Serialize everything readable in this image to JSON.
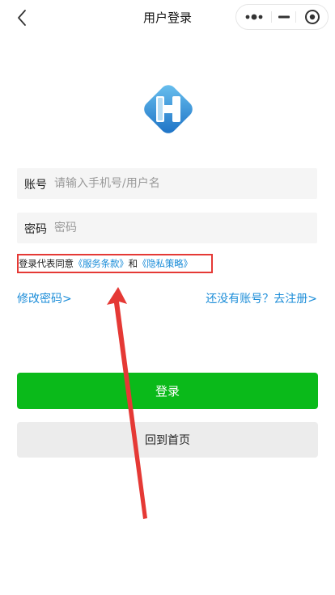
{
  "navbar": {
    "title": "用户登录",
    "back_icon": "chevron-left-icon",
    "capsule": {
      "more_icon": "more-dots-icon",
      "minimize_icon": "minimize-icon",
      "close_icon": "target-circle-icon"
    }
  },
  "logo": {
    "icon": "app-logo-icon",
    "colors": [
      "#2a9be0",
      "#1a6fc4",
      "#6cc3f0"
    ]
  },
  "form": {
    "account": {
      "label": "账号",
      "placeholder": "请输入手机号/用户名",
      "value": ""
    },
    "password": {
      "label": "密码",
      "placeholder": "密码",
      "value": ""
    }
  },
  "agreement": {
    "prefix": "登录代表同意",
    "terms_link": "《服务条款》",
    "conjunction": "和",
    "privacy_link": "《隐私策略》"
  },
  "links": {
    "change_password": "修改密码>",
    "register": "还没有账号？去注册>"
  },
  "buttons": {
    "login": "登录",
    "home": "回到首页"
  },
  "colors": {
    "link": "#1a8cd8",
    "primary_button": "#0aba1a",
    "secondary_button": "#ececec",
    "highlight_box": "#e53935",
    "annotation_arrow": "#e53935"
  }
}
